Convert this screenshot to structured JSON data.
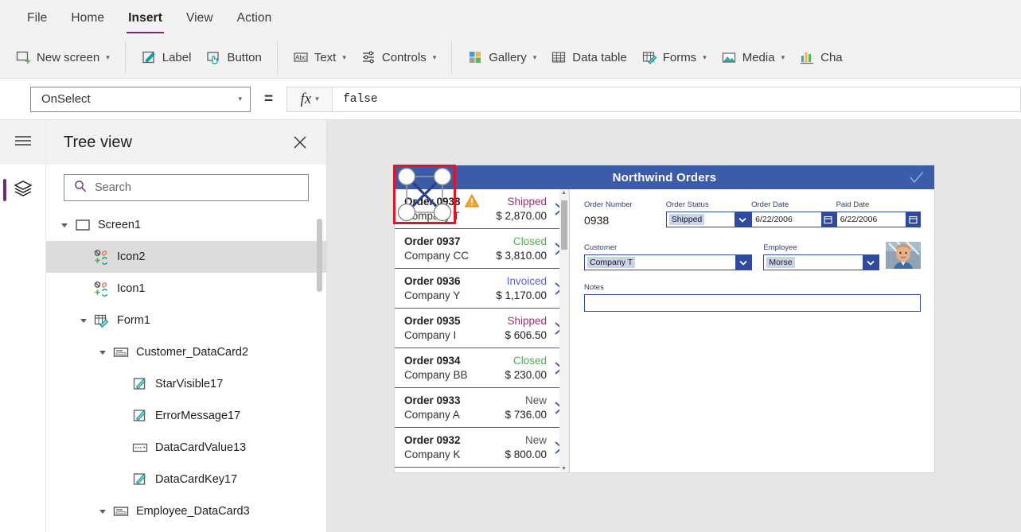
{
  "menu": {
    "items": [
      {
        "label": "File",
        "active": false
      },
      {
        "label": "Home",
        "active": false
      },
      {
        "label": "Insert",
        "active": true
      },
      {
        "label": "View",
        "active": false
      },
      {
        "label": "Action",
        "active": false
      }
    ]
  },
  "ribbon": {
    "groups": [
      {
        "buttons": [
          {
            "label": "New screen",
            "icon": "new-screen-icon",
            "caret": true
          }
        ]
      },
      {
        "buttons": [
          {
            "label": "Label",
            "icon": "label-icon",
            "caret": false
          },
          {
            "label": "Button",
            "icon": "button-icon",
            "caret": false
          }
        ]
      },
      {
        "buttons": [
          {
            "label": "Text",
            "icon": "text-icon",
            "caret": true
          },
          {
            "label": "Controls",
            "icon": "controls-icon",
            "caret": true
          }
        ]
      },
      {
        "buttons": [
          {
            "label": "Gallery",
            "icon": "gallery-icon",
            "caret": true
          },
          {
            "label": "Data table",
            "icon": "data-table-icon",
            "caret": false
          },
          {
            "label": "Forms",
            "icon": "forms-icon",
            "caret": true
          },
          {
            "label": "Media",
            "icon": "media-icon",
            "caret": true
          },
          {
            "label": "Cha",
            "icon": "charts-icon",
            "caret": false
          }
        ]
      }
    ]
  },
  "formula_bar": {
    "property": "OnSelect",
    "equals": "=",
    "fx_label": "fx",
    "formula": "false"
  },
  "tree_panel": {
    "title": "Tree view",
    "close_icon": "close-icon",
    "search": {
      "placeholder": "Search",
      "value": "",
      "icon": "search-icon"
    },
    "items": [
      {
        "label": "Screen1",
        "indent": 0,
        "twisty": "open",
        "icon": "screen-icon",
        "selected": false
      },
      {
        "label": "Icon2",
        "indent": 1,
        "twisty": "none",
        "icon": "icon-control",
        "selected": true
      },
      {
        "label": "Icon1",
        "indent": 1,
        "twisty": "none",
        "icon": "icon-control",
        "selected": false
      },
      {
        "label": "Form1",
        "indent": 1,
        "twisty": "open",
        "icon": "form-icon",
        "selected": false
      },
      {
        "label": "Customer_DataCard2",
        "indent": 2,
        "twisty": "open",
        "icon": "datacard-icon",
        "selected": false
      },
      {
        "label": "StarVisible17",
        "indent": 3,
        "twisty": "none",
        "icon": "label-ctl-icon",
        "selected": false
      },
      {
        "label": "ErrorMessage17",
        "indent": 3,
        "twisty": "none",
        "icon": "label-ctl-icon",
        "selected": false
      },
      {
        "label": "DataCardValue13",
        "indent": 3,
        "twisty": "none",
        "icon": "dropdown-ctl-icon",
        "selected": false
      },
      {
        "label": "DataCardKey17",
        "indent": 3,
        "twisty": "none",
        "icon": "label-ctl-icon",
        "selected": false
      },
      {
        "label": "Employee_DataCard3",
        "indent": 2,
        "twisty": "open",
        "icon": "datacard-icon",
        "selected": false
      }
    ]
  },
  "rail": {
    "menu_icon": "hamburger-icon",
    "buttons": [
      {
        "icon": "layers-icon",
        "active": true
      }
    ]
  },
  "app": {
    "header": {
      "title": "Northwind Orders",
      "check_icon": "check-icon"
    },
    "gallery": {
      "items": [
        {
          "order": "Order 0938",
          "company": "Company T",
          "status": "Shipped",
          "status_color": "#a4297a",
          "amount": "$ 2,870.00",
          "warning": true,
          "selected": true
        },
        {
          "order": "Order 0937",
          "company": "Company CC",
          "status": "Closed",
          "status_color": "#4caf50",
          "amount": "$ 3,810.00",
          "warning": false,
          "selected": false
        },
        {
          "order": "Order 0936",
          "company": "Company Y",
          "status": "Invoiced",
          "status_color": "#5566dd",
          "amount": "$ 1,170.00",
          "warning": false,
          "selected": false
        },
        {
          "order": "Order 0935",
          "company": "Company I",
          "status": "Shipped",
          "status_color": "#a4297a",
          "amount": "$ 606.50",
          "warning": false,
          "selected": false
        },
        {
          "order": "Order 0934",
          "company": "Company BB",
          "status": "Closed",
          "status_color": "#4caf50",
          "amount": "$ 230.00",
          "warning": false,
          "selected": false
        },
        {
          "order": "Order 0933",
          "company": "Company A",
          "status": "New",
          "status_color": "#555555",
          "amount": "$ 736.00",
          "warning": false,
          "selected": false
        },
        {
          "order": "Order 0932",
          "company": "Company K",
          "status": "New",
          "status_color": "#555555",
          "amount": "$ 800.00",
          "warning": false,
          "selected": false
        }
      ]
    },
    "detail": {
      "order_number_label": "Order Number",
      "order_number_value": "0938",
      "order_status_label": "Order Status",
      "order_status_value": "Shipped",
      "order_date_label": "Order Date",
      "order_date_value": "6/22/2006",
      "paid_date_label": "Paid Date",
      "paid_date_value": "6/22/2006",
      "customer_label": "Customer",
      "customer_value": "Company T",
      "employee_label": "Employee",
      "employee_value": "Morse",
      "notes_label": "Notes",
      "notes_value": ""
    },
    "selection": {
      "handle_count": 4,
      "border_color": "#e81123"
    }
  },
  "colors": {
    "accent_purple": "#742774",
    "app_header_blue": "#3b5ca8",
    "control_blue": "#2e4a9e",
    "warning_amber": "#f5a623"
  }
}
